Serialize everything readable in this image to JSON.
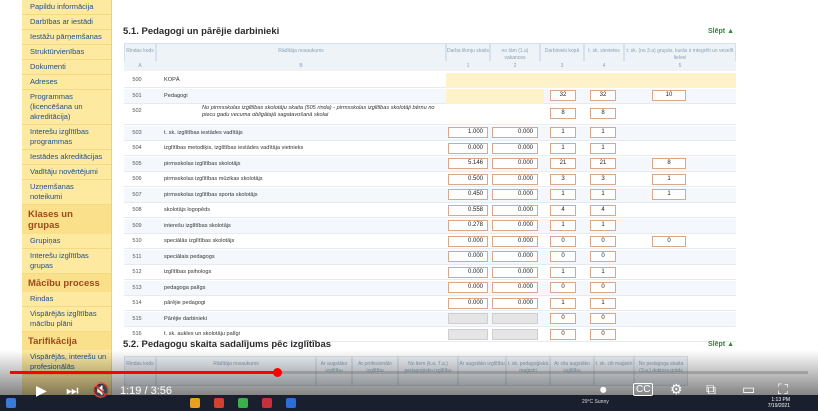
{
  "sidebar": {
    "items": [
      {
        "label": "Papildu informācija",
        "type": "item"
      },
      {
        "label": "Darbības ar iestādi",
        "type": "item"
      },
      {
        "label": "Iestāžu pārņemšanas",
        "type": "item"
      },
      {
        "label": "Struktūrvienības",
        "type": "item"
      },
      {
        "label": "Dokumenti",
        "type": "item"
      },
      {
        "label": "Adreses",
        "type": "item"
      },
      {
        "label": "Programmas (licencēšana un akreditācija)",
        "type": "item"
      },
      {
        "label": "Interešu izglītības programmas",
        "type": "item"
      },
      {
        "label": "Iestādes akreditācijas",
        "type": "item"
      },
      {
        "label": "Vadītāju novērtējumi",
        "type": "item"
      },
      {
        "label": "Uzņemšanas noteikumi",
        "type": "item"
      },
      {
        "label": "Klases un grupas",
        "type": "head"
      },
      {
        "label": "Grupiņas",
        "type": "item"
      },
      {
        "label": "Interešu izglītības grupas",
        "type": "item"
      },
      {
        "label": "Mācību process",
        "type": "head"
      },
      {
        "label": "Rindas",
        "type": "item"
      },
      {
        "label": "Vispārējās izglītības mācību plāni",
        "type": "item"
      },
      {
        "label": "Tarifikācija",
        "type": "head"
      },
      {
        "label": "Vispārējās, interešu un profesionālās",
        "type": "item"
      }
    ]
  },
  "section1": {
    "title": "5.1. Pedagogi un pārējie darbinieki",
    "hide_label": "Slēpt",
    "headers": {
      "code": "Rindas kods",
      "name": "Rādītāja nosaukums",
      "c1": "Darba likmju skaits",
      "c2": "no tām (1.a) vakances",
      "c3": "Darbinieki kopā",
      "c4": "t. sk. sievietes",
      "c5": "t. sk. (no 3.a) grupās, kurās ir integrēti un veselīt lielvei"
    },
    "subheaders": {
      "code": "A",
      "name": "B",
      "c1": "1",
      "c2": "2",
      "c3": "3",
      "c4": "4",
      "c5": "5"
    },
    "rows": [
      {
        "code": "500",
        "name": "KOPĀ",
        "c1": "",
        "c2": "",
        "c3": "",
        "c4": "",
        "c5": "",
        "kind": "total"
      },
      {
        "code": "501",
        "name": "Pedagogi",
        "c1": "",
        "c2": "",
        "c3": "32",
        "c4": "32",
        "c5": "10",
        "kind": "yellow"
      },
      {
        "code": "502",
        "name": "No pirmsskolas izglītības skolotāju skaita (505 rinda) - pirmsskolas izglītības skolotāji bērnu no piecu gadu vecuma obligātajā sagatavošanā skolai",
        "c1": "",
        "c2": "",
        "c3": "8",
        "c4": "8",
        "c5": "",
        "kind": "italic"
      },
      {
        "code": "503",
        "name": "t. sk. izglītības iestādes vadītājs",
        "c1": "1.000",
        "c2": "0.000",
        "c3": "1",
        "c4": "1",
        "c5": "",
        "kind": "normal"
      },
      {
        "code": "504",
        "name": "izglītības metodiķis, izglītības iestādes vadītāja vietnieks",
        "c1": "0.000",
        "c2": "0.000",
        "c3": "1",
        "c4": "1",
        "c5": "",
        "kind": "normal"
      },
      {
        "code": "505",
        "name": "pirmsskolas izglītības skolotājs",
        "c1": "5.146",
        "c2": "0.000",
        "c3": "21",
        "c4": "21",
        "c5": "8",
        "kind": "normal"
      },
      {
        "code": "506",
        "name": "pirmsskolas izglītības mūzikas skolotājs",
        "c1": "0.500",
        "c2": "0.000",
        "c3": "3",
        "c4": "3",
        "c5": "1",
        "kind": "normal"
      },
      {
        "code": "507",
        "name": "pirmsskolas izglītības sporta skolotājs",
        "c1": "0.450",
        "c2": "0.000",
        "c3": "1",
        "c4": "1",
        "c5": "1",
        "kind": "normal"
      },
      {
        "code": "508",
        "name": "skolotājs logopēds",
        "c1": "0.558",
        "c2": "0.000",
        "c3": "4",
        "c4": "4",
        "c5": "",
        "kind": "normal"
      },
      {
        "code": "509",
        "name": "interešu izglītības skolotājs",
        "c1": "0.278",
        "c2": "0.000",
        "c3": "1",
        "c4": "1",
        "c5": "",
        "kind": "normal"
      },
      {
        "code": "510",
        "name": "speciālās izglītības skolotājs",
        "c1": "0.000",
        "c2": "0.000",
        "c3": "0",
        "c4": "0",
        "c5": "0",
        "kind": "normal"
      },
      {
        "code": "511",
        "name": "speciālais pedagogs",
        "c1": "0.000",
        "c2": "0.000",
        "c3": "0",
        "c4": "0",
        "c5": "",
        "kind": "normal"
      },
      {
        "code": "512",
        "name": "izglītības psihologs",
        "c1": "0.000",
        "c2": "0.000",
        "c3": "1",
        "c4": "1",
        "c5": "",
        "kind": "normal"
      },
      {
        "code": "513",
        "name": "pedagoga palīgs",
        "c1": "0.000",
        "c2": "0.000",
        "c3": "0",
        "c4": "0",
        "c5": "",
        "kind": "normal"
      },
      {
        "code": "514",
        "name": "pārējie pedagogi",
        "c1": "0.000",
        "c2": "0.000",
        "c3": "1",
        "c4": "1",
        "c5": "",
        "kind": "normal"
      },
      {
        "code": "515",
        "name": "Pārējie darbinieki",
        "c1": "",
        "c2": "",
        "c3": "0",
        "c4": "0",
        "c5": "",
        "kind": "grey"
      },
      {
        "code": "516",
        "name": "t. sk. aukles un skolotāju palīgi",
        "c1": "",
        "c2": "",
        "c3": "0",
        "c4": "0",
        "c5": "",
        "kind": "grey"
      }
    ]
  },
  "section2": {
    "title": "5.2. Pedagogu skaita sadalījums pēc izglītības",
    "hide_label": "Slēpt",
    "headers": [
      "Rindas kods",
      "Rādītāja nosaukums",
      "Ar augstāko izglītību",
      "Ar profesionālo izglītību",
      "No tiem (k.a. 7.a.) pedagoģisko izglītību",
      "Ar augstāko izglītību",
      "t. sk. pedagoģiskā maģistri",
      "Ar citu augstāko izglītību",
      "t. sk. citi maģistri",
      "No pedagoga skaita (3.a.) doktora grāds"
    ]
  },
  "player": {
    "timecode": "1:19 / 3:56",
    "progress": 0.335,
    "clock_time": "1:13 PM",
    "clock_date": "7/19/2021",
    "tray_text": "29°C Sunny"
  }
}
